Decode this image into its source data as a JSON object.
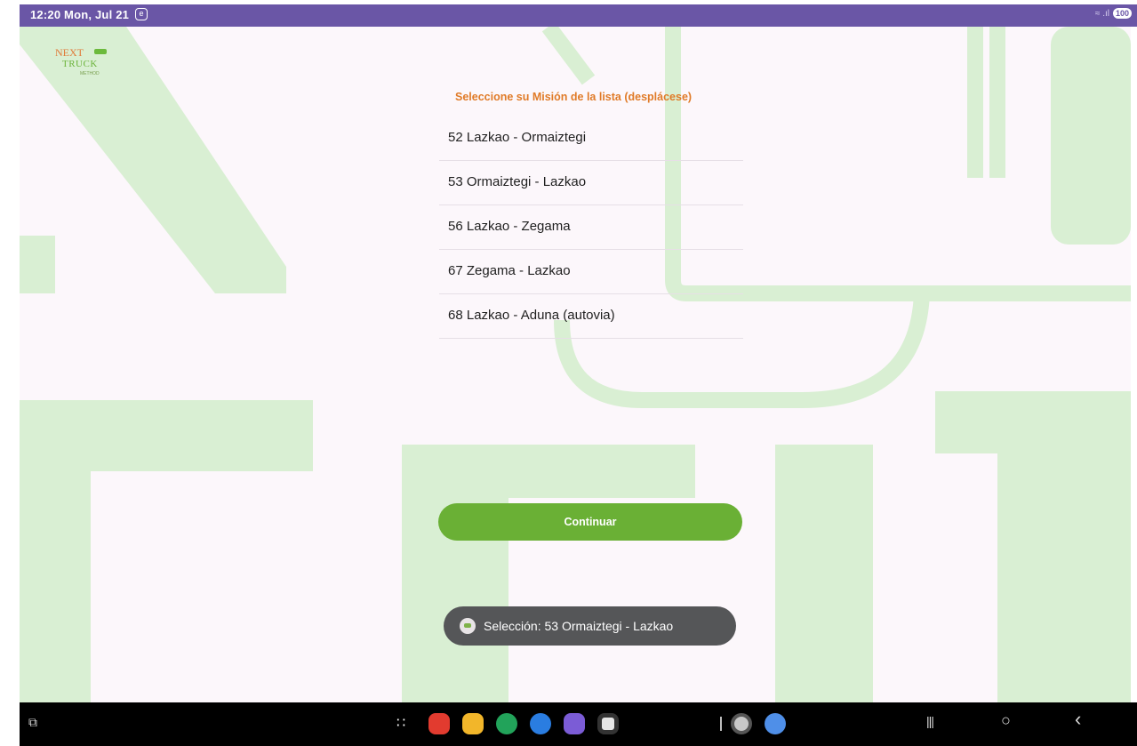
{
  "status_bar": {
    "time": "12:20  Mon, Jul 21",
    "notification_glyph": "e",
    "signal": "≈ .ıl",
    "battery": "100"
  },
  "logo": {
    "line1": "NEXT",
    "line2": "TRUCK",
    "line3": "METHOD"
  },
  "mission_list": {
    "title": "Seleccione su Misión de la lista (desplácese)",
    "items": [
      "52 Lazkao - Ormaiztegi",
      "53 Ormaiztegi - Lazkao",
      "56 Lazkao - Zegama",
      "67 Zegama - Lazkao",
      "68 Lazkao - Aduna (autovia)"
    ]
  },
  "continue_button": {
    "label": "Continuar"
  },
  "toast": {
    "text": "Selección: 53 Ormaiztegi - Lazkao"
  },
  "navbar": {
    "screenshot_glyph": "⧉",
    "apps_glyph": "∷",
    "recents_glyph": "|||",
    "home_glyph": "○",
    "back_glyph": "‹",
    "dock_icons": [
      {
        "name": "red-app-icon",
        "color": "#e23b2f"
      },
      {
        "name": "yellow-app-icon",
        "color": "#f2b62a"
      },
      {
        "name": "phone-icon",
        "color": "#22a35a"
      },
      {
        "name": "messages-icon",
        "color": "#2a7de1"
      },
      {
        "name": "browser-icon",
        "color": "#7b5cd6"
      },
      {
        "name": "camera-icon",
        "color": "#e6e6e6"
      },
      {
        "name": "settings-icon",
        "color": "#c8c8c8"
      },
      {
        "name": "assistant-icon",
        "color": "#4f8fe8"
      }
    ]
  },
  "colors": {
    "status_bar": "#6a56a6",
    "title_orange": "#e07b28",
    "button_green": "#6ab035",
    "background": "#fcf7fb",
    "watermark_green": "#d9efd3"
  }
}
